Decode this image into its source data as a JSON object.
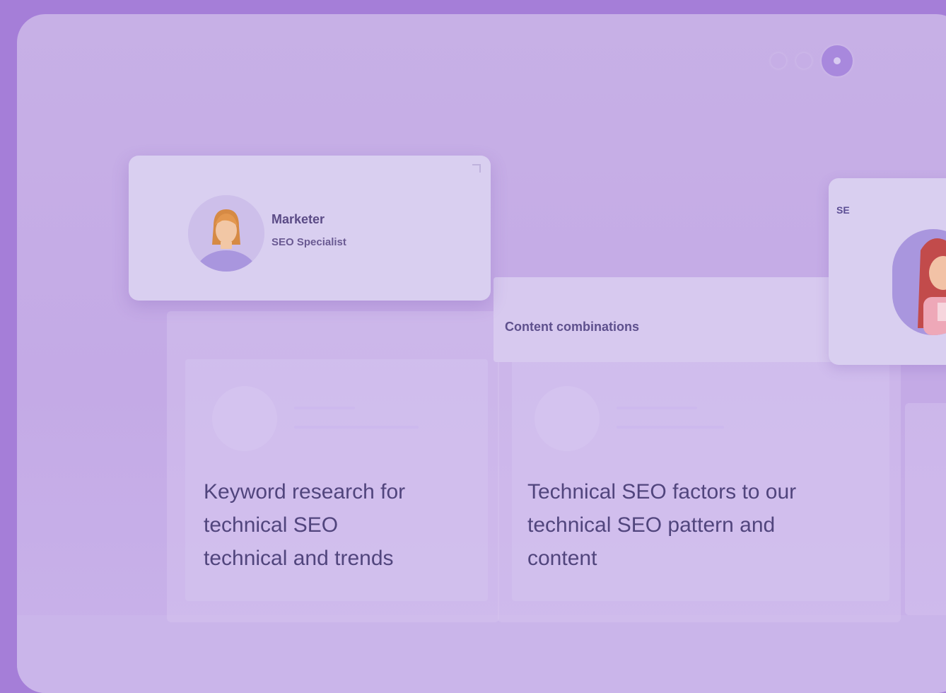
{
  "window": {
    "controls": [
      "minimize",
      "maximize",
      "close"
    ]
  },
  "profile_card": {
    "name": "Marketer",
    "subtitle": "SEO Specialist",
    "avatar_icon": "person-avatar-icon"
  },
  "column_header": {
    "label": "Content combinations"
  },
  "side_card": {
    "tag": "SE",
    "avatar_icon": "person-avatar-icon"
  },
  "posts": [
    {
      "text_lines": [
        "Keyword research for",
        "technical SEO",
        "technical and trends"
      ]
    },
    {
      "text_lines": [
        "Technical SEO factors to our",
        "technical SEO pattern and",
        "content"
      ]
    }
  ],
  "colors": {
    "background": "#a57ed8",
    "frame": "#c7b0e6",
    "card": "#d9cff0",
    "text": "#51457d"
  }
}
